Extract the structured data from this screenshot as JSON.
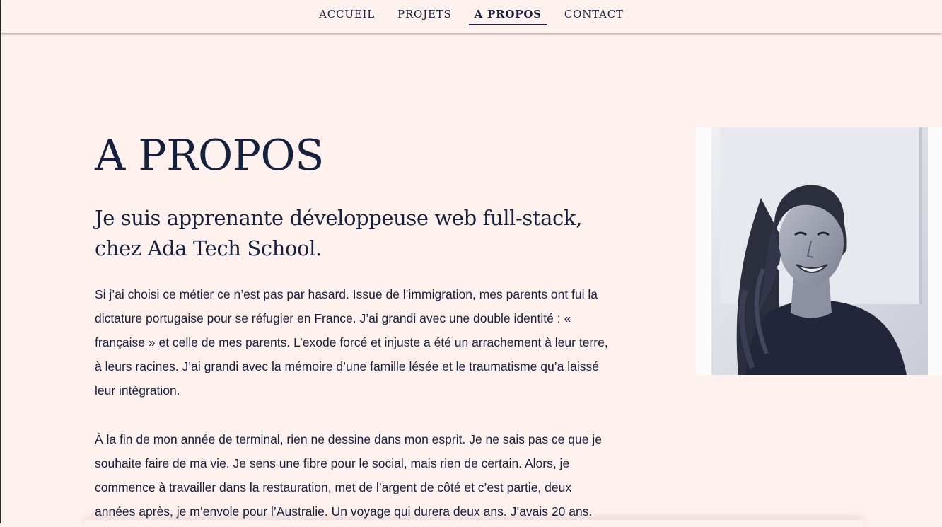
{
  "nav": {
    "items": [
      {
        "label": "ACCUEIL",
        "active": false
      },
      {
        "label": "PROJETS",
        "active": false
      },
      {
        "label": "A PROPOS",
        "active": true
      },
      {
        "label": "CONTACT",
        "active": false
      }
    ]
  },
  "main": {
    "title": "A PROPOS",
    "subtitle": "Je suis apprenante développeuse web full-stack, chez Ada Tech School.",
    "paragraphs": [
      "Si j’ai choisi ce métier ce n’est pas par hasard. Issue de l’immigration, mes parents ont fui la dictature portugaise pour se réfugier en France. J’ai grandi avec une double identité : « française » et celle de mes parents. L’exode forcé et injuste a été un arrachement à leur terre, à leurs racines. J’ai grandi avec la mémoire d’une famille lésée et le traumatisme qu’a laissé leur intégration.",
      "À la fin de mon année de terminal, rien ne dessine dans mon esprit. Je ne sais pas ce que je souhaite faire de ma vie. Je sens une fibre pour le social, mais rien de certain. Alors, je commence à travailler dans la restauration, met de l’argent de côté et c’est partie, deux années après, je m’envole pour l’Australie. Un voyage qui durera deux ans. J’avais 20 ans."
    ]
  },
  "colors": {
    "background": "#fff1ee",
    "text": "#16213e"
  },
  "portrait": {
    "icon": "portrait-photo"
  }
}
